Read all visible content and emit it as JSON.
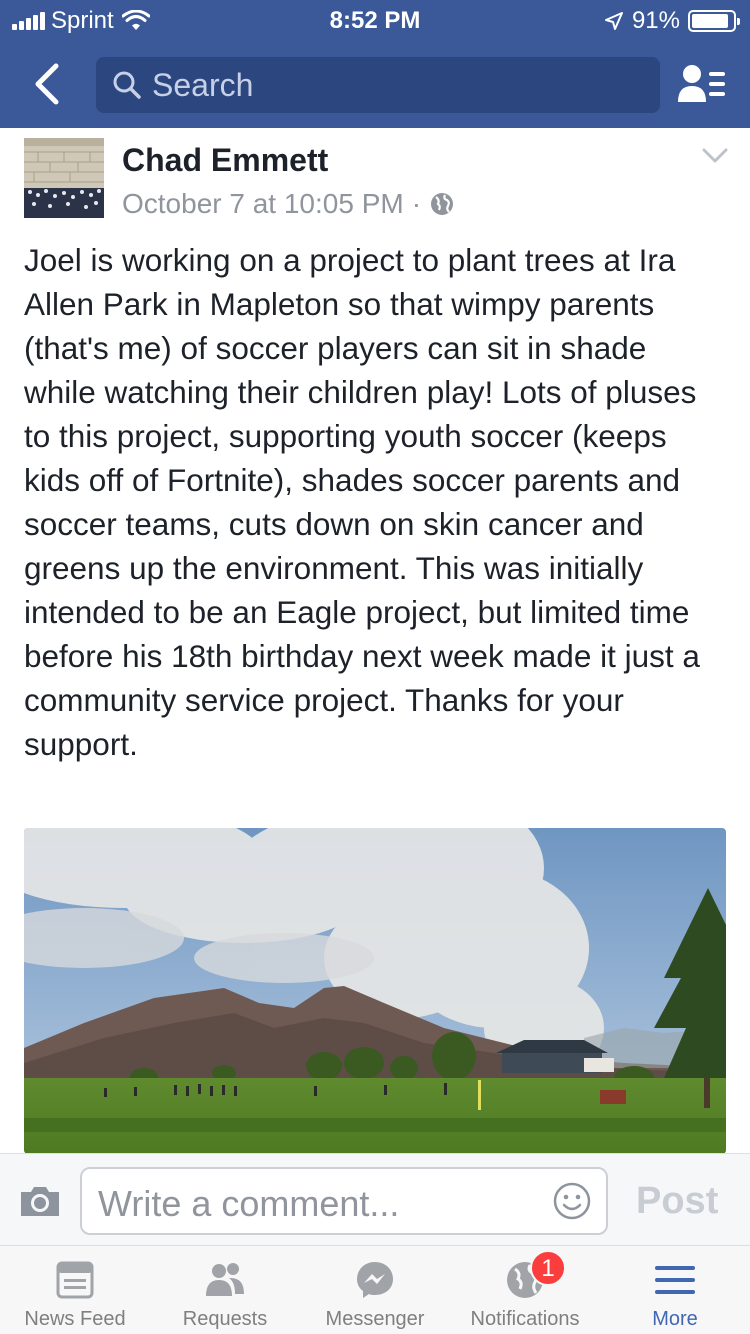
{
  "status_bar": {
    "carrier": "Sprint",
    "time": "8:52 PM",
    "battery": "91%",
    "battery_level": 0.91
  },
  "nav": {
    "back_icon": "chevron-left-icon",
    "search_placeholder": "Search",
    "friends_icon": "friends-list-icon"
  },
  "post": {
    "author": "Chad Emmett",
    "timestamp": "October 7 at 10:05 PM",
    "separator": "·",
    "privacy_icon": "globe-icon",
    "text": "Joel is working on a project to plant trees at Ira Allen Park in Mapleton so that wimpy parents (that's me) of soccer players can sit in shade while watching their children play! Lots of pluses to this project, supporting youth soccer (keeps kids off of Fortnite), shades soccer parents and soccer teams, cuts down on skin cancer and greens up the environment. This was initially intended to be an Eagle project, but limited time before his 18th birthday next week made it just a community service project. Thanks for your support."
  },
  "comment_bar": {
    "placeholder": "Write a comment...",
    "post_label": "Post"
  },
  "tabs": [
    {
      "label": "News Feed",
      "icon": "news-feed-icon"
    },
    {
      "label": "Requests",
      "icon": "friend-requests-icon"
    },
    {
      "label": "Messenger",
      "icon": "messenger-icon"
    },
    {
      "label": "Notifications",
      "icon": "globe-icon",
      "badge": "1"
    },
    {
      "label": "More",
      "icon": "menu-icon",
      "active": true
    }
  ],
  "colors": {
    "brand": "#3b5998",
    "active_tab": "#4267b2",
    "badge": "#fa3e3e"
  }
}
